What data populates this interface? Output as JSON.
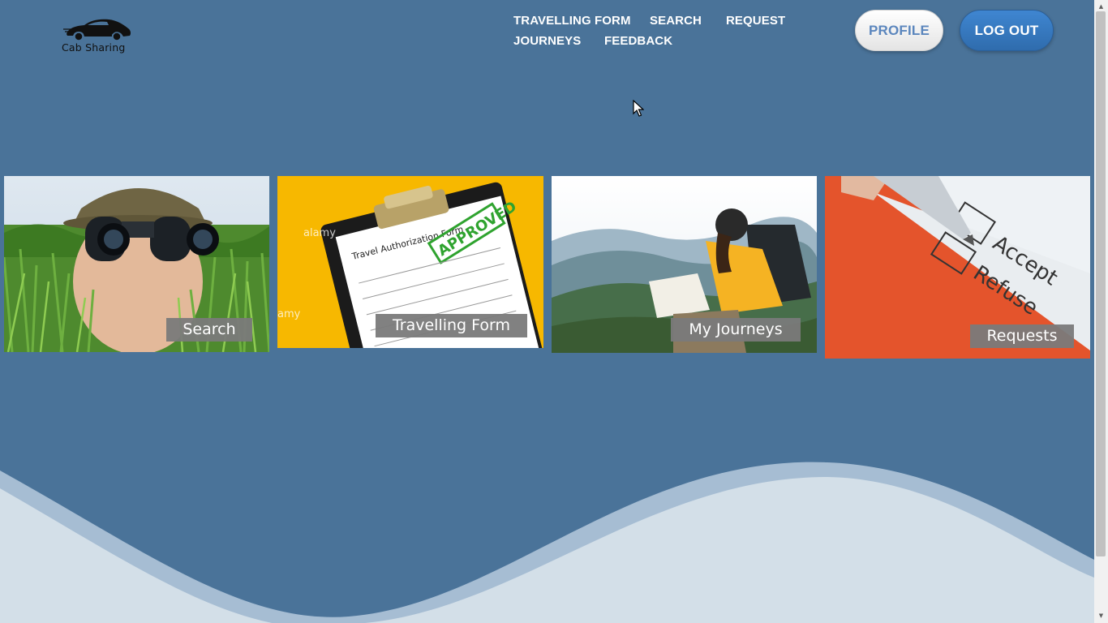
{
  "brand": {
    "name": "Cab Sharing",
    "logo_icon": "car-icon"
  },
  "nav": {
    "items": [
      {
        "label": "TRAVELLING FORM"
      },
      {
        "label": "SEARCH"
      },
      {
        "label": "REQUEST"
      },
      {
        "label": "JOURNEYS"
      },
      {
        "label": "FEEDBACK"
      }
    ]
  },
  "header": {
    "profile_label": "PROFILE",
    "logout_label": "LOG OUT"
  },
  "cards": [
    {
      "label": "Search",
      "image": "person-with-binoculars-photo"
    },
    {
      "label": "Travelling Form",
      "image": "approved-travel-authorization-form-photo",
      "image_text": [
        "Travel Authorization Form",
        "APPROVED",
        "alamy"
      ]
    },
    {
      "label": "My Journeys",
      "image": "hiker-with-map-in-mountains-photo"
    },
    {
      "label": "Requests",
      "image": "accept-refuse-checkbox-photo",
      "image_text": [
        "Accept",
        "Refuse"
      ]
    }
  ],
  "colors": {
    "background": "#4a7399",
    "wave_light": "#d3dfe8",
    "wave_mid": "#a6bdd3",
    "profile_text": "#5b86bd",
    "logout_bg": "#3477c2",
    "card_label_bg": "#7a7a7a"
  }
}
